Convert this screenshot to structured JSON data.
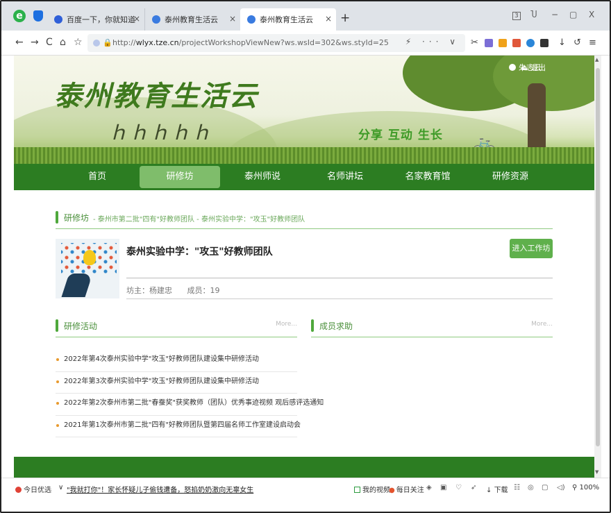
{
  "browser": {
    "tabs": [
      {
        "label": "百度一下，你就知道",
        "close": "×"
      },
      {
        "label": "泰州教育生活云",
        "close": "×"
      },
      {
        "label": "泰州教育生活云",
        "close": "×"
      }
    ],
    "new_tab": "+",
    "window_controls": {
      "badge": "3",
      "shirt": "Ⴎ",
      "minimize": "−",
      "restore": "▢",
      "close": "X"
    },
    "nav": {
      "back": "←",
      "forward": "→",
      "reload": "C",
      "home": "⌂",
      "star": "☆"
    },
    "url_prefix": "http://",
    "url_host": "wlyx.tze.cn",
    "url_path": "/projectWorkshopViewNew?ws.wsId=302&ws.styId=25",
    "url_tools": "⚡ ··· ∨",
    "right_tools": [
      "✂",
      "↓",
      "↺",
      "≡"
    ]
  },
  "site": {
    "logo_text": "泰州教育生活云",
    "people_text": "ｈｈｈｈｈ",
    "slogan": "分享  互动  生长",
    "user_name": "朱志云",
    "logout_label": "退出",
    "bike": "🚲",
    "menu": [
      "首页",
      "研修坊",
      "泰州师说",
      "名师讲坛",
      "名家教育馆",
      "研修资源"
    ],
    "menu_active_index": 1
  },
  "breadcrumb": {
    "main": "研修坊",
    "trail": "- 泰州市第二批\"四有\"好教师团队  -  泰州实验中学：\"攻玉\"好教师团队"
  },
  "team": {
    "title": "泰州实验中学：\"攻玉\"好教师团队",
    "owner": "坊主：杨建忠",
    "members": "成员：19",
    "enter_button": "进入工作坊"
  },
  "activities": {
    "title": "研修活动",
    "more": "More...",
    "items": [
      "2022年第4次泰州实验中学\"攻玉\"好教师团队建设集中研修活动",
      "2022年第3次泰州实验中学\"攻玉\"好教师团队建设集中研修活动",
      "2022年第2次泰州市第二批\"春蚕奖\"获奖教师（团队）优秀事迹视频 观后感评选通知",
      "2021年第1次泰州市第二批\"四有\"好教师团队暨第四届名师工作室建设启动会"
    ]
  },
  "members_panel": {
    "title": "成员求助",
    "more": "More..."
  },
  "statusbar": {
    "today": "今日优选",
    "chevron": "∨",
    "news": "\"我就打你\"！家长怀疑儿子偷钱遭备，怒掐奶奶激向无辜女生",
    "my_video": "我的视频",
    "daily": "每日关注",
    "download": "下载",
    "zoom": "100%"
  },
  "colors": {
    "menu_green": "#2c7d22",
    "active_tab": "#7fbd6b",
    "button_green": "#5fb04c",
    "accent_line": "#8fca80"
  }
}
